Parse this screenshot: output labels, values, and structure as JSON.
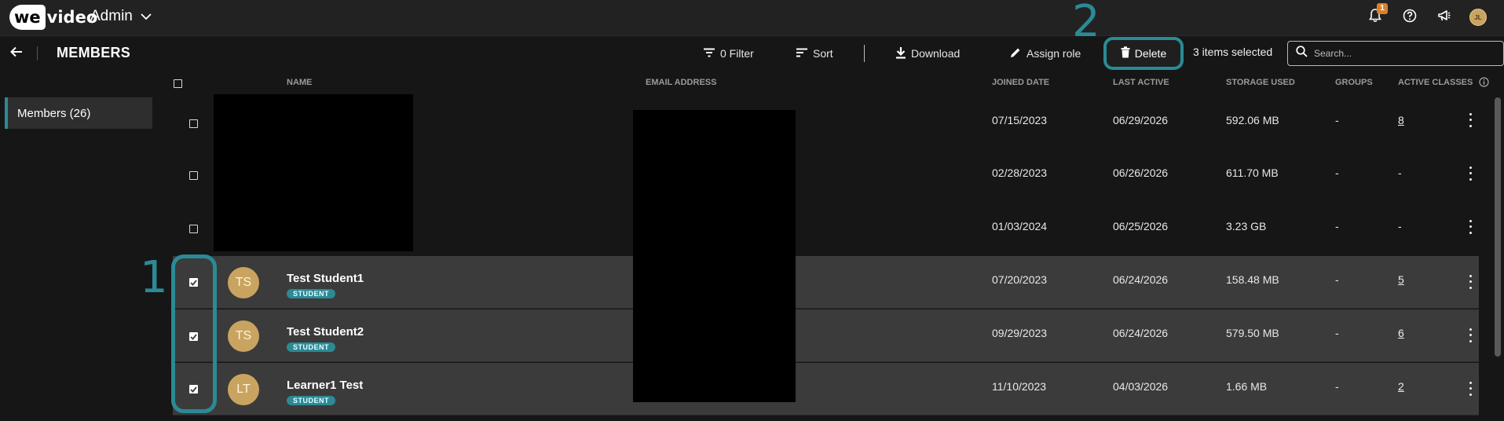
{
  "app": {
    "logo_we": "we",
    "logo_video": "video",
    "workspace_label": "Admin",
    "notification_count": "1",
    "user_initials": "JL"
  },
  "header": {
    "title": "MEMBERS",
    "filter_label": "0 Filter",
    "sort_label": "Sort",
    "download_label": "Download",
    "assign_role_label": "Assign role",
    "delete_label": "Delete",
    "selected_text": "3 items selected",
    "search_placeholder": "Search..."
  },
  "sidebar": {
    "items": [
      {
        "label": "Members (26)",
        "active": true
      }
    ]
  },
  "table": {
    "columns": [
      "NAME",
      "EMAIL ADDRESS",
      "JOINED DATE",
      "LAST ACTIVE",
      "STORAGE USED",
      "GROUPS",
      "ACTIVE CLASSES"
    ],
    "rows": [
      {
        "checked": false,
        "initials": "",
        "name": "",
        "role": "",
        "joined": "07/15/2023",
        "last_active": "06/29/2026",
        "storage": "592.06 MB",
        "groups": "-",
        "active_classes": "8",
        "classes_link": true
      },
      {
        "checked": false,
        "initials": "",
        "name": "",
        "role": "",
        "joined": "02/28/2023",
        "last_active": "06/26/2026",
        "storage": "611.70 MB",
        "groups": "-",
        "active_classes": "-",
        "classes_link": false
      },
      {
        "checked": false,
        "initials": "",
        "name": "",
        "role": "",
        "joined": "01/03/2024",
        "last_active": "06/25/2026",
        "storage": "3.23 GB",
        "groups": "-",
        "active_classes": "-",
        "classes_link": false
      },
      {
        "checked": true,
        "initials": "TS",
        "name": "Test Student1",
        "role": "STUDENT",
        "joined": "07/20/2023",
        "last_active": "06/24/2026",
        "storage": "158.48 MB",
        "groups": "-",
        "active_classes": "5",
        "classes_link": true
      },
      {
        "checked": true,
        "initials": "TS",
        "name": "Test Student2",
        "role": "STUDENT",
        "joined": "09/29/2023",
        "last_active": "06/24/2026",
        "storage": "579.50 MB",
        "groups": "-",
        "active_classes": "6",
        "classes_link": true
      },
      {
        "checked": true,
        "initials": "LT",
        "name": "Learner1 Test",
        "role": "STUDENT",
        "joined": "11/10/2023",
        "last_active": "04/03/2026",
        "storage": "1.66 MB",
        "groups": "-",
        "active_classes": "2",
        "classes_link": true
      }
    ]
  },
  "annotations": {
    "step1": "1",
    "step2": "2"
  },
  "colors": {
    "accent": "#2b8a96",
    "background": "#161616",
    "selected_row": "#3b3b3b",
    "avatar": "#c9a460"
  }
}
